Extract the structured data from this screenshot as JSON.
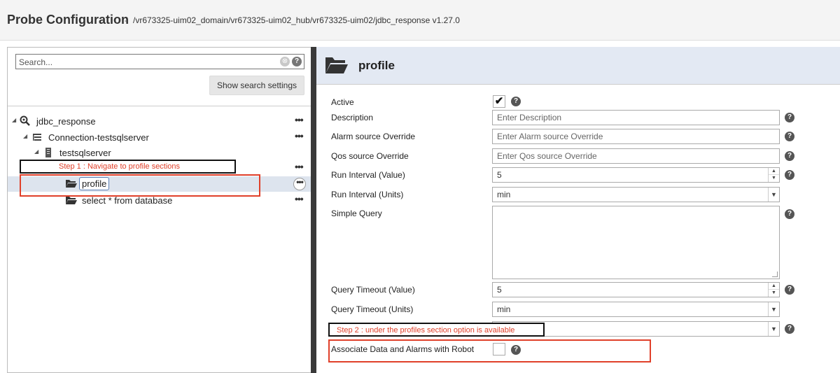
{
  "header": {
    "title": "Probe Configuration",
    "separator": "-",
    "path": "/vr673325-uim02_domain/vr673325-uim02_hub/vr673325-uim02/jdbc_response v1.27.0"
  },
  "sidebar": {
    "search_placeholder": "Search...",
    "clear_glyph": "⊗",
    "help_glyph": "?",
    "search_settings_label": "Show search settings",
    "more_glyph": "•••",
    "tree": [
      {
        "label": "jdbc_response",
        "icon": "probe-search-icon"
      },
      {
        "label": "Connection-testsqlserver",
        "icon": "connection-icon"
      },
      {
        "label": "testsqlserver",
        "icon": "server-icon"
      },
      {
        "label": "profile",
        "icon": "folder-icon"
      },
      {
        "label": "select * from database",
        "icon": "folder-icon"
      }
    ]
  },
  "annotations": {
    "step1": "Step 1 :  Navigate to profile sections",
    "step2": "Step 2 : under the profiles section option is available",
    "color_red": "#e0402a",
    "color_black": "#111111"
  },
  "detail": {
    "title": "profile",
    "fields": {
      "active": {
        "label": "Active",
        "checked": true,
        "check_glyph": "✔"
      },
      "description": {
        "label": "Description",
        "placeholder": "Enter Description"
      },
      "alarm_source": {
        "label": "Alarm source Override",
        "placeholder": "Enter Alarm source Override"
      },
      "qos_source": {
        "label": "Qos source Override",
        "placeholder": "Enter Qos source Override"
      },
      "run_interval_value": {
        "label": "Run Interval (Value)",
        "value": "5"
      },
      "run_interval_units": {
        "label": "Run Interval (Units)",
        "value": "min"
      },
      "simple_query": {
        "label": "Simple Query",
        "value": ""
      },
      "query_timeout_value": {
        "label": "Query Timeout (Value)",
        "value": "5"
      },
      "query_timeout_units": {
        "label": "Query Timeout (Units)",
        "value": "min"
      },
      "associate": {
        "label": "Associate Data and Alarms with Robot",
        "checked": false
      }
    },
    "spin_up": "▲",
    "spin_down": "▼",
    "dropdown_glyph": "▼",
    "help_glyph": "?"
  },
  "colors": {
    "header_bg": "#e3e9f3",
    "selected_bg": "#dde4ee",
    "splitter": "#3a3a3a"
  }
}
